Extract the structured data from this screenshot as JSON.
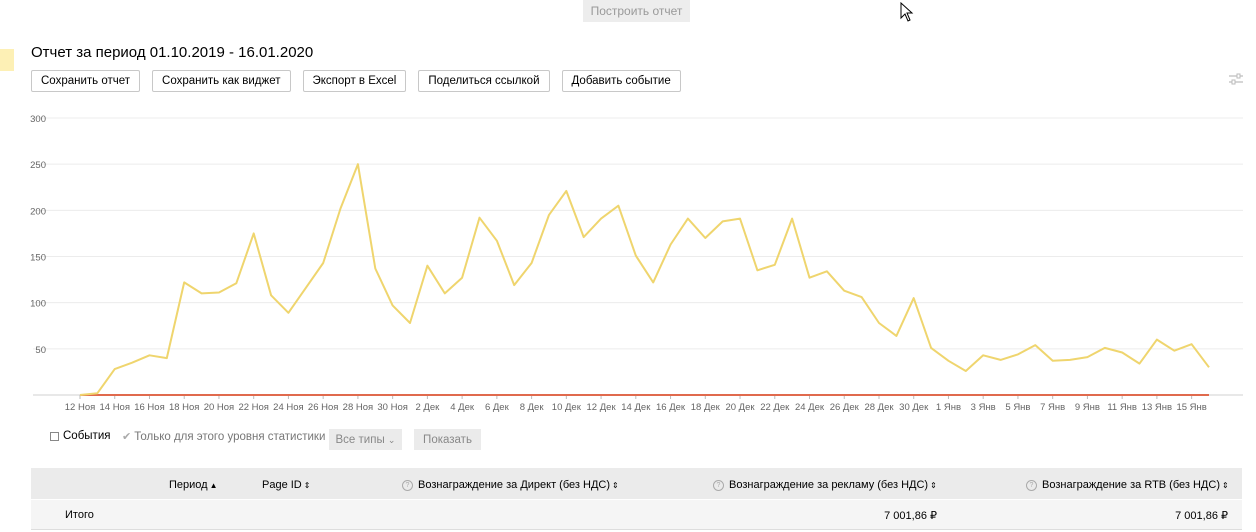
{
  "build_button": "Построить отчет",
  "report_title": "Отчет за период 01.10.2019 - 16.01.2020",
  "toolbar": {
    "save_report": "Сохранить отчет",
    "save_widget": "Сохранить как виджет",
    "export_excel": "Экспорт в Excel",
    "share_link": "Поделиться ссылкой",
    "add_event": "Добавить событие"
  },
  "chart_data": {
    "type": "line",
    "y_ticks": [
      "300",
      "250",
      "200",
      "150",
      "100",
      "50"
    ],
    "x_ticks": [
      "12 Ноя",
      "14 Ноя",
      "16 Ноя",
      "18 Ноя",
      "20 Ноя",
      "22 Ноя",
      "24 Ноя",
      "26 Ноя",
      "28 Ноя",
      "30 Ноя",
      "2 Дек",
      "4 Дек",
      "6 Дек",
      "8 Дек",
      "10 Дек",
      "12 Дек",
      "14 Дек",
      "16 Дек",
      "18 Дек",
      "20 Дек",
      "22 Дек",
      "24 Дек",
      "26 Дек",
      "28 Дек",
      "30 Дек",
      "1 Янв",
      "3 Янв",
      "5 Янв",
      "7 Янв",
      "9 Янв",
      "11 Янв",
      "13 Янв",
      "15 Янв"
    ],
    "ylim": [
      0,
      300
    ],
    "grid": true,
    "series": [
      {
        "color": "#efd56e",
        "values": [
          0,
          2,
          28,
          35,
          43,
          40,
          122,
          110,
          111,
          121,
          175,
          108,
          89,
          116,
          143,
          202,
          250,
          137,
          97,
          78,
          140,
          110,
          127,
          192,
          167,
          119,
          143,
          195,
          221,
          171,
          191,
          205,
          151,
          122,
          163,
          191,
          170,
          188,
          191,
          135,
          141,
          191,
          127,
          134,
          113,
          106,
          78,
          64,
          105,
          51,
          37,
          26,
          43,
          38,
          44,
          54,
          37,
          38,
          41,
          51,
          46,
          34,
          60,
          48,
          55,
          30
        ]
      },
      {
        "color": "#e06a4d",
        "values": [
          0,
          0,
          0,
          0,
          0,
          0,
          0,
          0,
          0,
          0,
          0,
          0,
          0,
          0,
          0,
          0,
          0,
          0,
          0,
          0,
          0,
          0,
          0,
          0,
          0,
          0,
          0,
          0,
          0,
          0,
          0,
          0,
          0,
          0,
          0,
          0,
          0,
          0,
          0,
          0,
          0,
          0,
          0,
          0,
          0,
          0,
          0,
          0,
          0,
          0,
          0,
          0,
          0,
          0,
          0,
          0,
          0,
          0,
          0,
          0,
          0,
          0,
          0,
          0,
          0,
          0
        ]
      }
    ]
  },
  "events_label": "События",
  "only_level_label": "Только для этого уровня статистики",
  "types_select": "Все типы",
  "show_button": "Показать",
  "table": {
    "headers": {
      "period": "Период",
      "page_id": "Page ID",
      "direct": "Вознаграждение за Директ (без НДС)",
      "ads": "Вознаграждение за рекламу (без НДС)",
      "rtb": "Вознаграждение за RTB (без НДС)"
    },
    "total_label": "Итого",
    "total_ads": "7 001,86 ₽",
    "total_rtb": "7 001,86 ₽"
  }
}
